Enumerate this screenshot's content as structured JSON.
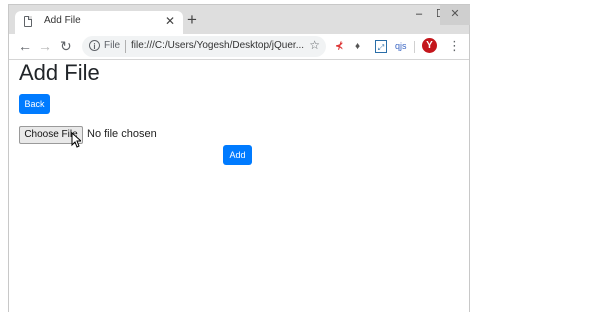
{
  "browser": {
    "tab": {
      "title": "Add File",
      "icon": "page-icon"
    },
    "new_tab_label": "+",
    "window_controls": {
      "minimize": "‒",
      "maximize": "☐",
      "close": "✕"
    },
    "omnibox": {
      "scheme": "File",
      "url": "file:///C:/Users/Yogesh/Desktop/jQuer..."
    },
    "extensions": [
      "ext-1",
      "ext-2",
      "ext-3",
      "qjs"
    ],
    "profile_initial": "Y"
  },
  "page": {
    "heading": "Add File",
    "back_button": "Back",
    "file_input": {
      "button_label": "Choose File",
      "status": "No file chosen"
    },
    "add_button": "Add"
  },
  "colors": {
    "primary": "#007bff",
    "titlebar": "#dedede"
  }
}
